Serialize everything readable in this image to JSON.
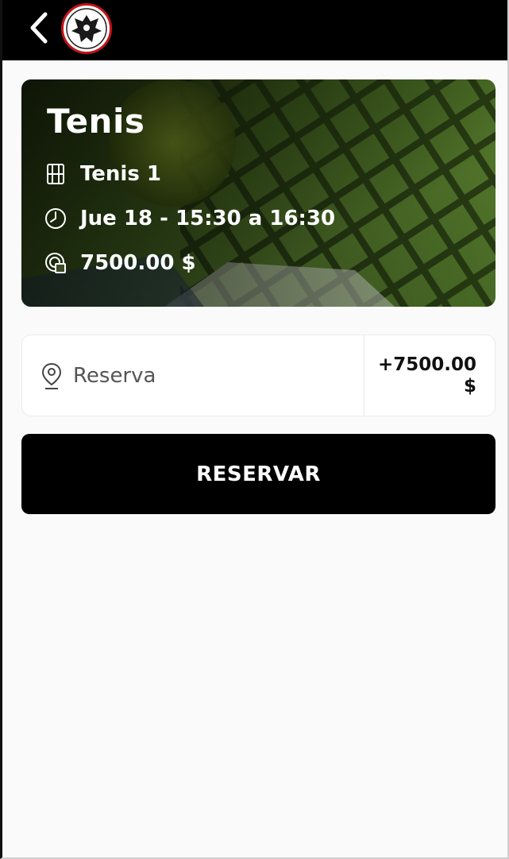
{
  "header": {
    "back_icon": "chevron-left-icon",
    "logo": "club-crest-logo"
  },
  "hero": {
    "title": "Tenis",
    "court": "Tenis 1",
    "datetime": "Jue 18 - 15:30 a 16:30",
    "price": "7500.00 $",
    "icons": [
      "court-icon",
      "clock-icon",
      "price-icon"
    ]
  },
  "line_item": {
    "icon": "location-pin-icon",
    "label": "Reserva",
    "amount_line1": "+7500.00",
    "amount_line2": "$"
  },
  "actions": {
    "reserve_label": "RESERVAR"
  },
  "colors": {
    "topbar": "#000000",
    "button": "#000000",
    "logo_ring": "#c3141a",
    "background": "#fafafa"
  }
}
